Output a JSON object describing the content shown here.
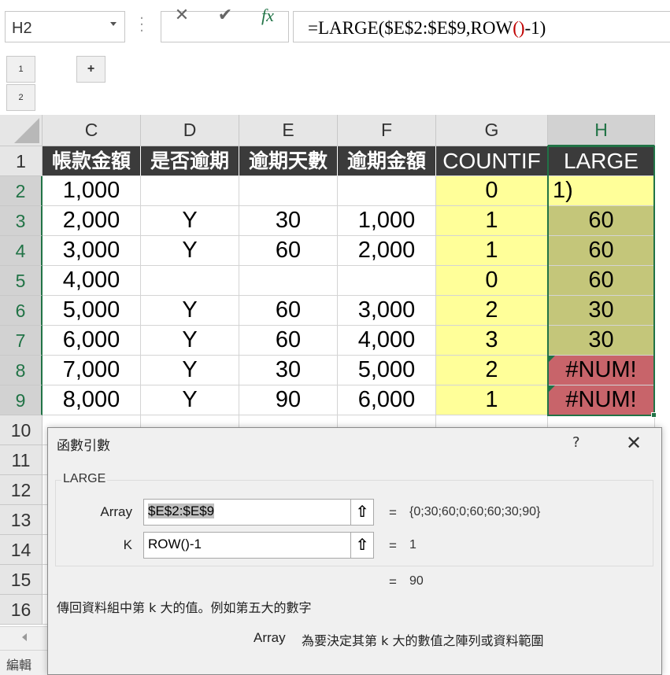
{
  "formula_bar": {
    "name_box": "H2",
    "cancel_glyph": "✕",
    "enter_glyph": "✔",
    "fx_glyph": "fx",
    "formula_part1": "=LARGE($E$2:$E$9,ROW",
    "formula_paren": "()",
    "formula_part2": "-1)"
  },
  "outline": {
    "level1": "1",
    "level2": "2",
    "expand": "+"
  },
  "columns": [
    "C",
    "D",
    "E",
    "F",
    "G",
    "H"
  ],
  "selected_column": "H",
  "rows": [
    "1",
    "2",
    "3",
    "4",
    "5",
    "6",
    "7",
    "8",
    "9",
    "10",
    "11",
    "12",
    "13",
    "14",
    "15",
    "16"
  ],
  "table": {
    "headers": [
      "帳款金額",
      "是否逾期",
      "逾期天數",
      "逾期金額",
      "COUNTIF",
      "LARGE"
    ],
    "data": [
      [
        "1,000",
        "",
        "",
        "",
        "0",
        "1)"
      ],
      [
        "2,000",
        "Y",
        "30",
        "1,000",
        "1",
        "60"
      ],
      [
        "3,000",
        "Y",
        "60",
        "2,000",
        "1",
        "60"
      ],
      [
        "4,000",
        "",
        "",
        "",
        "0",
        "60"
      ],
      [
        "5,000",
        "Y",
        "60",
        "3,000",
        "2",
        "30"
      ],
      [
        "6,000",
        "Y",
        "60",
        "4,000",
        "3",
        "30"
      ],
      [
        "7,000",
        "Y",
        "30",
        "5,000",
        "2",
        "#NUM!"
      ],
      [
        "8,000",
        "Y",
        "90",
        "6,000",
        "1",
        "#NUM!"
      ]
    ]
  },
  "colors": {
    "header_bg": "#3b3b3b",
    "countif_fill": "#ffff99",
    "large_fill": "#c4c67a",
    "error_fill": "#c8646a",
    "selection": "#217346"
  },
  "dialog": {
    "title": "函數引數",
    "help": "?",
    "close": "✕",
    "function_name": "LARGE",
    "arg1_label": "Array",
    "arg1_value": "$E$2:$E$9",
    "arg1_result": "{0;30;60;0;60;60;30;90}",
    "arg2_label": "K",
    "arg2_value": "ROW()-1",
    "arg2_result": "1",
    "collapse_glyph": "⇧",
    "equals": "=",
    "formula_result": "90",
    "description": "傳回資料組中第 k 大的值。例如第五大的數字",
    "arg_desc_name": "Array",
    "arg_desc": "為要決定其第 k 大的數值之陣列或資料範圍"
  },
  "status": {
    "mode": "編輯"
  }
}
